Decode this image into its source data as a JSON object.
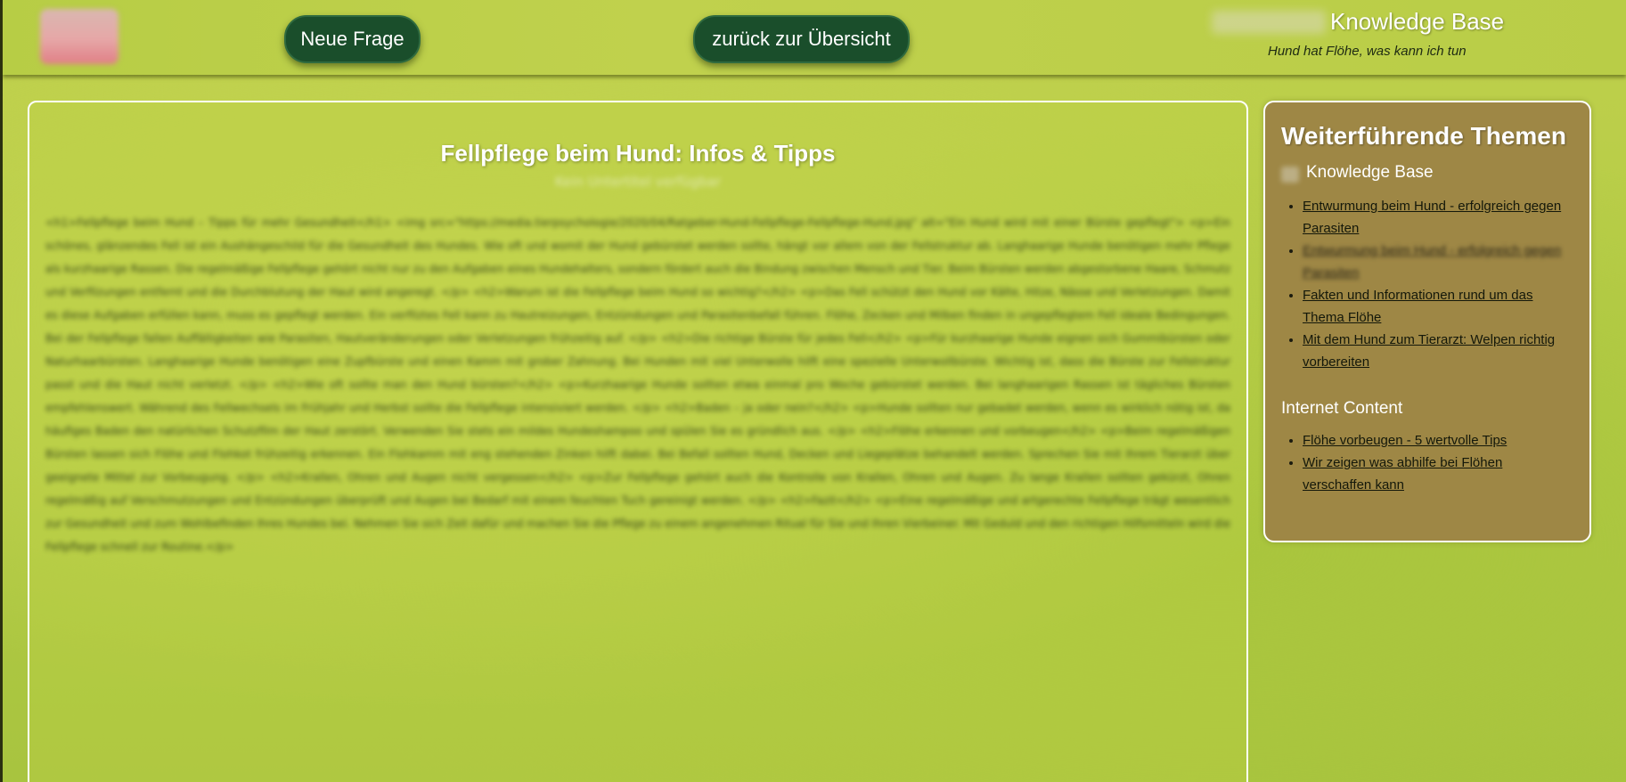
{
  "header": {
    "new_question_label": "Neue Frage",
    "back_label": "zurück zur Übersicht",
    "brand_title": "Knowledge Base",
    "brand_subtitle": "Hund hat Flöhe, was kann ich tun"
  },
  "article": {
    "title": "Fellpflege beim Hund: Infos & Tipps",
    "subtitle": "Kein Untertitel verfügbar",
    "body": "<h1>Fellpflege beim Hund – Tipps für mehr Gesundheit</h1> <img src=\"https://media.tierpsychologie/2020/04/Ratgeber-Hund-Fellpflege-Fellpflege-Hund.jpg\" alt=\"Ein Hund wird mit einer Bürste gepflegt\"> <p>Ein schönes, glänzendes Fell ist ein Aushängeschild für die Gesundheit des Hundes. Wie oft und womit der Hund gebürstet werden sollte, hängt vor allem von der Fellstruktur ab. Langhaarige Hunde benötigen mehr Pflege als kurzhaarige Rassen. Die regelmäßige Fellpflege gehört nicht nur zu den Aufgaben eines Hundehalters, sondern fördert auch die Bindung zwischen Mensch und Tier. Beim Bürsten werden abgestorbene Haare, Schmutz und Verfilzungen entfernt und die Durchblutung der Haut wird angeregt. </p> <h2>Warum ist die Fellpflege beim Hund so wichtig?</h2> <p>Das Fell schützt den Hund vor Kälte, Hitze, Nässe und Verletzungen. Damit es diese Aufgaben erfüllen kann, muss es gepflegt werden. Ein verfilztes Fell kann zu Hautreizungen, Entzündungen und Parasitenbefall führen. Flöhe, Zecken und Milben finden in ungepflegtem Fell ideale Bedingungen. Bei der Fellpflege fallen Auffälligkeiten wie Parasiten, Hautveränderungen oder Verletzungen frühzeitig auf. </p> <h2>Die richtige Bürste für jedes Fell</h2> <p>Für kurzhaarige Hunde eignen sich Gummibürsten oder Naturhaarbürsten. Langhaarige Hunde benötigen eine Zupfbürste und einen Kamm mit grober Zahnung. Bei Hunden mit viel Unterwolle hilft eine spezielle Unterwollbürste. Wichtig ist, dass die Bürste zur Fellstruktur passt und die Haut nicht verletzt. </p> <h2>Wie oft sollte man den Hund bürsten?</h2> <p>Kurzhaarige Hunde sollten etwa einmal pro Woche gebürstet werden. Bei langhaarigen Rassen ist tägliches Bürsten empfehlenswert. Während des Fellwechsels im Frühjahr und Herbst sollte die Fellpflege intensiviert werden. </p> <h2>Baden – ja oder nein?</h2> <p>Hunde sollten nur gebadet werden, wenn es wirklich nötig ist, da häufiges Baden den natürlichen Schutzfilm der Haut zerstört. Verwenden Sie stets ein mildes Hundeshampoo und spülen Sie es gründlich aus. </p> <h2>Flöhe erkennen und vorbeugen</h2> <p>Beim regelmäßigen Bürsten lassen sich Flöhe und Flohkot frühzeitig erkennen. Ein Flohkamm mit eng stehenden Zinken hilft dabei. Bei Befall sollten Hund, Decken und Liegeplätze behandelt werden. Sprechen Sie mit Ihrem Tierarzt über geeignete Mittel zur Vorbeugung. </p> <h2>Krallen, Ohren und Augen nicht vergessen</h2> <p>Zur Fellpflege gehört auch die Kontrolle von Krallen, Ohren und Augen. Zu lange Krallen sollten gekürzt, Ohren regelmäßig auf Verschmutzungen und Entzündungen überprüft und Augen bei Bedarf mit einem feuchten Tuch gereinigt werden. </p> <h2>Fazit</h2> <p>Eine regelmäßige und artgerechte Fellpflege trägt wesentlich zur Gesundheit und zum Wohlbefinden Ihres Hundes bei. Nehmen Sie sich Zeit dafür und machen Sie die Pflege zu einem angenehmen Ritual für Sie und Ihren Vierbeiner. Mit Geduld und den richtigen Hilfsmitteln wird die Fellpflege schnell zur Routine.</p>"
  },
  "sidebar": {
    "title": "Weiterführende Themen",
    "kb_heading": "Knowledge Base",
    "kb_links": [
      "Entwurmung beim Hund - erfolgreich gegen Parasiten",
      "Entwurmung beim Hund - erfolgreich gegen Parasiten",
      "Fakten und Informationen rund um das Thema Flöhe",
      "Mit dem Hund zum Tierarzt: Welpen richtig vorbereiten"
    ],
    "internet_heading": "Internet Content",
    "internet_links": [
      "Flöhe vorbeugen - 5 wertvolle Tips",
      "Wir zeigen was abhilfe bei Flöhen verschaffen kann"
    ]
  },
  "colors": {
    "background": "#b7cd45",
    "button_bg": "#1a4e2b",
    "sidebar_bg": "#9e8745",
    "panel_border": "#ffffff"
  },
  "icons": {
    "logo": "brand-logo",
    "knowledge_base": "knowledge-base-icon"
  }
}
